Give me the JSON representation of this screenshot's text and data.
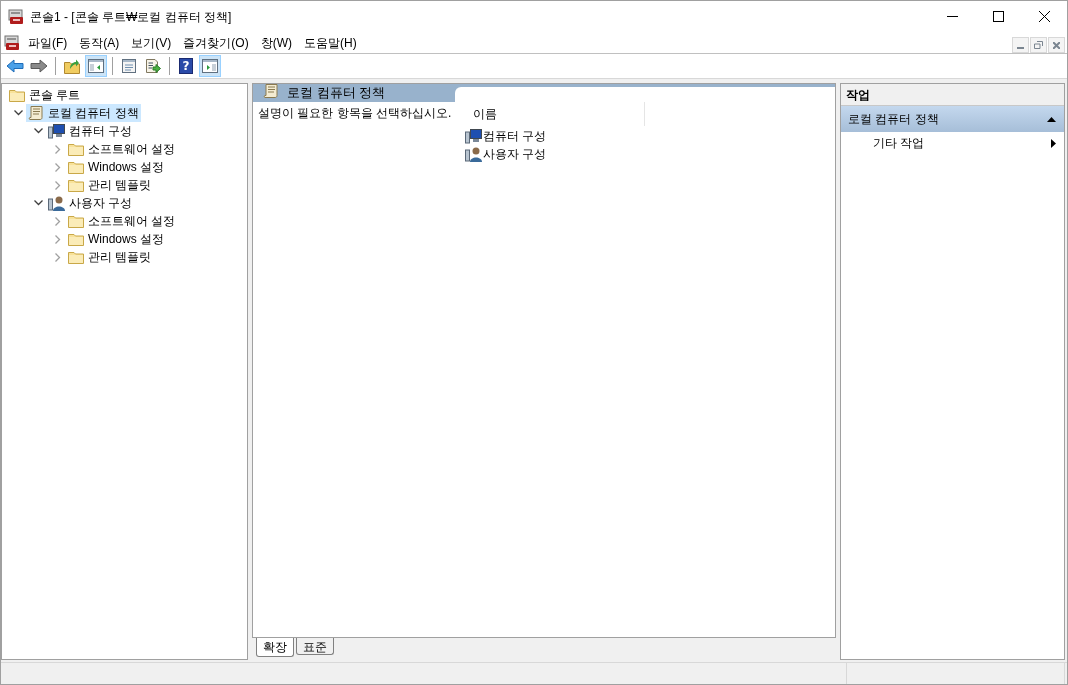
{
  "window": {
    "title": "콘솔1 - [콘솔 루트₩로컬 컴퓨터 정책]"
  },
  "menu": [
    "파일(F)",
    "동작(A)",
    "보기(V)",
    "즐겨찾기(O)",
    "창(W)",
    "도움말(H)"
  ],
  "toolbar": [
    {
      "kind": "back",
      "pressed": false
    },
    {
      "kind": "forward",
      "pressed": false
    },
    {
      "kind": "separator"
    },
    {
      "kind": "up",
      "pressed": false
    },
    {
      "kind": "tree",
      "pressed": true
    },
    {
      "kind": "separator"
    },
    {
      "kind": "properties",
      "pressed": false
    },
    {
      "kind": "export",
      "pressed": false
    },
    {
      "kind": "separator"
    },
    {
      "kind": "help",
      "glyph": "?",
      "pressed": false
    },
    {
      "kind": "action-pane",
      "pressed": true
    }
  ],
  "tree": [
    {
      "label": "콘솔 루트",
      "kind": "folder",
      "selected": false,
      "children": [
        {
          "label": "로컬 컴퓨터 정책",
          "kind": "policy",
          "selected": true,
          "expanded": true,
          "children": [
            {
              "label": "컴퓨터 구성",
              "kind": "computer",
              "selected": false,
              "expanded": true,
              "children": [
                {
                  "label": "소프트웨어 설정",
                  "kind": "folder",
                  "selected": false,
                  "expanded": false
                },
                {
                  "label": "Windows 설정",
                  "kind": "folder",
                  "selected": false,
                  "expanded": false
                },
                {
                  "label": "관리 템플릿",
                  "kind": "folder",
                  "selected": false,
                  "expanded": false
                }
              ]
            },
            {
              "label": "사용자 구성",
              "kind": "user",
              "selected": false,
              "expanded": true,
              "children": [
                {
                  "label": "소프트웨어 설정",
                  "kind": "folder",
                  "selected": false,
                  "expanded": false
                },
                {
                  "label": "Windows 설정",
                  "kind": "folder",
                  "selected": false,
                  "expanded": false
                },
                {
                  "label": "관리 템플릿",
                  "kind": "folder",
                  "selected": false,
                  "expanded": false
                }
              ]
            }
          ]
        }
      ]
    }
  ],
  "center": {
    "title": "로컬 컴퓨터 정책",
    "description": "설명이 필요한 항목을 선택하십시오.",
    "column": "이름",
    "items": [
      {
        "label": "컴퓨터 구성",
        "kind": "computer"
      },
      {
        "label": "사용자 구성",
        "kind": "user"
      }
    ],
    "tabs": [
      {
        "label": "확장",
        "selected": true
      },
      {
        "label": "표준",
        "selected": false
      }
    ]
  },
  "actions": {
    "title": "작업",
    "sections": [
      {
        "label": "로컬 컴퓨터 정책",
        "expanded": true,
        "items": [
          {
            "label": "기타 작업"
          }
        ]
      }
    ]
  }
}
